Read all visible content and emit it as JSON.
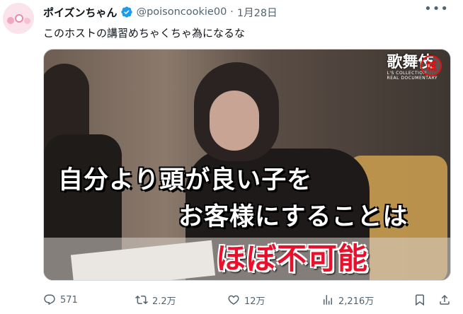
{
  "author": {
    "display_name": "ポイズンちゃん",
    "handle": "@poisoncookie00",
    "separator": "·",
    "date": "1月28日",
    "verified": true,
    "verified_color": "#1d9bf0"
  },
  "tweet": {
    "text": "このホストの講習めちゃくちゃ為になるな"
  },
  "media": {
    "brand_title": "歌舞伎",
    "brand_subtitle_1": "L'S COLLECTION",
    "brand_subtitle_2": "REAL DOCUMENTARY",
    "brand_seal": "城",
    "caption_line1": "自分より頭が良い子を",
    "caption_line2": "お客様にすることは",
    "caption_line3": "ほぼ不可能"
  },
  "actions": {
    "reply_count": "571",
    "retweet_count": "2.2万",
    "like_count": "12万",
    "views_count": "2,216万"
  },
  "colors": {
    "text_primary": "#0f1419",
    "text_secondary": "#536471",
    "caption_red": "#e8102a"
  },
  "icons": [
    "avatar",
    "verified-badge-icon",
    "more-icon",
    "reply-icon",
    "retweet-icon",
    "like-icon",
    "views-icon",
    "bookmark-icon",
    "share-icon"
  ]
}
